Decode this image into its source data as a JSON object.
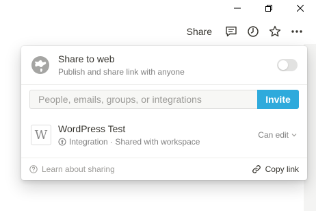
{
  "window": {
    "minimize_icon": "minimize-icon",
    "restore_icon": "restore-icon",
    "close_icon": "close-icon"
  },
  "topbar": {
    "share_label": "Share",
    "icons": [
      "comment-icon",
      "history-icon",
      "star-icon",
      "more-icon"
    ]
  },
  "share_to_web": {
    "title": "Share to web",
    "subtitle": "Publish and share link with anyone",
    "enabled": false
  },
  "invite": {
    "placeholder": "People, emails, groups, or integrations",
    "button_label": "Invite"
  },
  "members": [
    {
      "avatar_letter": "W",
      "name": "WordPress Test",
      "subtitle": "Integration · Shared with workspace",
      "permission": "Can edit"
    }
  ],
  "footer": {
    "learn_label": "Learn about sharing",
    "copy_label": "Copy link"
  },
  "colors": {
    "accent": "#2eaadc",
    "text": "#37352f",
    "muted": "#808080"
  }
}
